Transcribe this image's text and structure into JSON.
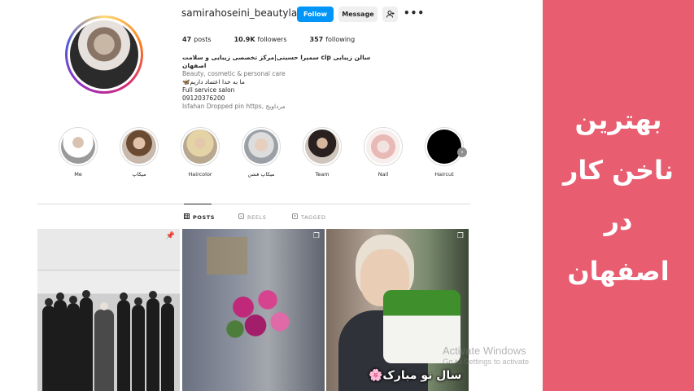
{
  "profile": {
    "username": "samirahoseini_beautyland",
    "follow_label": "Follow",
    "message_label": "Message",
    "add_user_icon": "person-add-icon",
    "more_icon": "more-dots-icon",
    "stats": {
      "posts_count": "47",
      "posts_label": "posts",
      "followers_count": "10.9K",
      "followers_label": "followers",
      "following_count": "357",
      "following_label": "following"
    },
    "bio": {
      "name": "سالن زیبایی cip سمیرا حسینی|مرکز تخصصی زیبایی و سلامت اصفهان",
      "category": "Beauty, cosmetic & personal care",
      "line1": "ما به خدا اعتماد داریم🦋",
      "line2": "Full service salon",
      "phone": "09120376200",
      "location": "Isfahan Dropped pin https, مرداویج"
    }
  },
  "highlights": [
    {
      "label": "Me"
    },
    {
      "label": "میکاپ"
    },
    {
      "label": "Haircolor"
    },
    {
      "label": "میکاپ فشن"
    },
    {
      "label": "Team"
    },
    {
      "label": "Nail"
    },
    {
      "label": "Haircut"
    }
  ],
  "tabs": [
    {
      "label": "POSTS",
      "icon": "grid-icon",
      "active": true
    },
    {
      "label": "REELS",
      "icon": "reels-icon",
      "active": false
    },
    {
      "label": "TAGGED",
      "icon": "tag-icon",
      "active": false
    }
  ],
  "posts": {
    "post3_caption": "سال نو مبارک🌸"
  },
  "watermark": {
    "line1": "Activate Windows",
    "line2": "Go to Settings to activate"
  },
  "side_panel": {
    "lines": [
      "بهترین",
      "ناخن کار",
      "در",
      "اصفهان"
    ],
    "background": "#e85d70"
  },
  "colors": {
    "follow_blue": "#0095f6"
  }
}
